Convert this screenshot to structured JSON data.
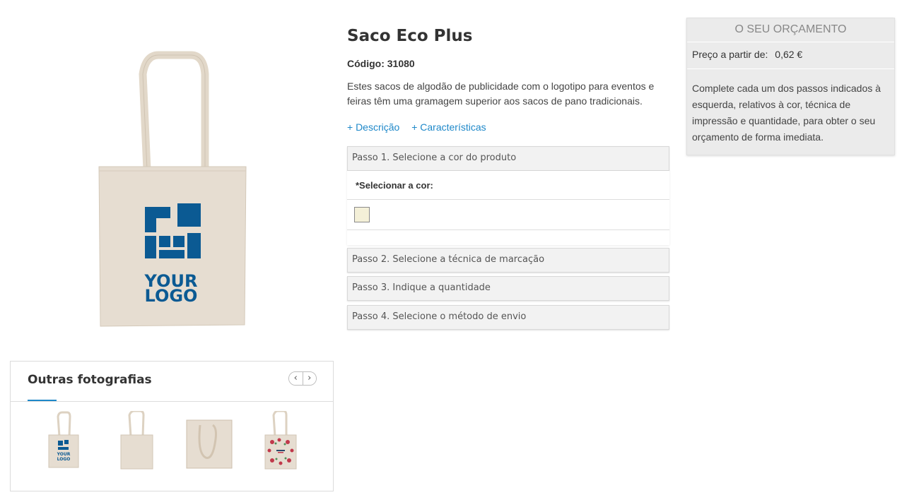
{
  "product": {
    "title": "Saco Eco Plus",
    "code": "Código: 31080",
    "description": "Estes sacos de algodão de publicidade com o logotipo para eventos e feiras têm uma gramagem superior aos sacos de pano tradicionais.",
    "links": [
      "+ Descrição",
      "+ Características"
    ],
    "logo_text": [
      "YOUR",
      "LOGO"
    ]
  },
  "steps": [
    {
      "label": "Passo 1. Selecione a cor do produto"
    },
    {
      "label": "Passo 2. Selecione a técnica de marcação"
    },
    {
      "label": "Passo 3. Indique a quantidade"
    },
    {
      "label": "Passo 4. Selecione o método de envio"
    }
  ],
  "color_select": {
    "label": "*Selecionar a cor:",
    "swatch_color": "#f4f0d8"
  },
  "gallery": {
    "title": "Outras fotografias",
    "prev_icon": "chevron-left-icon",
    "next_icon": "chevron-right-icon",
    "accent": "#1e88c9"
  },
  "quote": {
    "title": "O SEU ORÇAMENTO",
    "price_label": "Preço a partir de:",
    "price_value": "0,62 €",
    "instructions": "Complete cada um dos passos indicados à esquerda, relativos à cor, técnica de impressão e quantidade, para obter o seu orçamento de forma imediata."
  },
  "colors": {
    "bag": "#e6ddd1",
    "logo": "#0b5a93",
    "link": "#1e88c9"
  }
}
